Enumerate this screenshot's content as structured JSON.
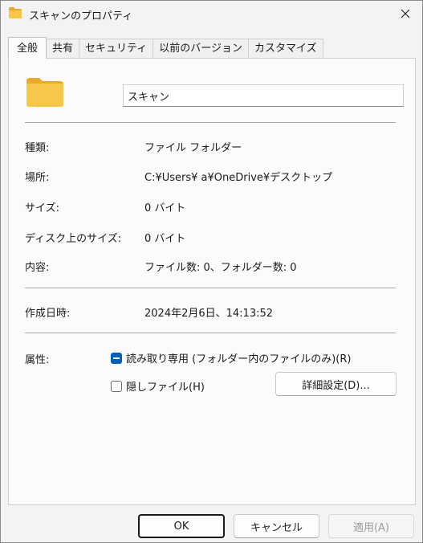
{
  "window": {
    "title": "スキャンのプロパティ"
  },
  "tabs": [
    {
      "label": "全般",
      "active": true
    },
    {
      "label": "共有"
    },
    {
      "label": "セキュリティ"
    },
    {
      "label": "以前のバージョン"
    },
    {
      "label": "カスタマイズ"
    }
  ],
  "general": {
    "name_value": "スキャン",
    "type_label": "種類:",
    "type_value": "ファイル フォルダー",
    "location_label": "場所:",
    "location_value": "C:¥Users¥        a¥OneDrive¥デスクトップ",
    "size_label": "サイズ:",
    "size_value": "0 バイト",
    "disk_size_label": "ディスク上のサイズ:",
    "disk_size_value": "0 バイト",
    "contains_label": "内容:",
    "contains_value": "ファイル数: 0、フォルダー数: 0",
    "created_label": "作成日時:",
    "created_value": "2024年2月6日、14:13:52",
    "attributes_label": "属性:",
    "readonly_label": "読み取り専用 (フォルダー内のファイルのみ)(R)",
    "readonly_state": "mixed",
    "hidden_label": "隠しファイル(H)",
    "hidden_checked": false,
    "advanced_button": "詳細設定(D)..."
  },
  "footer": {
    "ok": "OK",
    "cancel": "キャンセル",
    "apply": "適用(A)"
  },
  "colors": {
    "folder": "#f8c74a",
    "accent": "#005fb8"
  }
}
